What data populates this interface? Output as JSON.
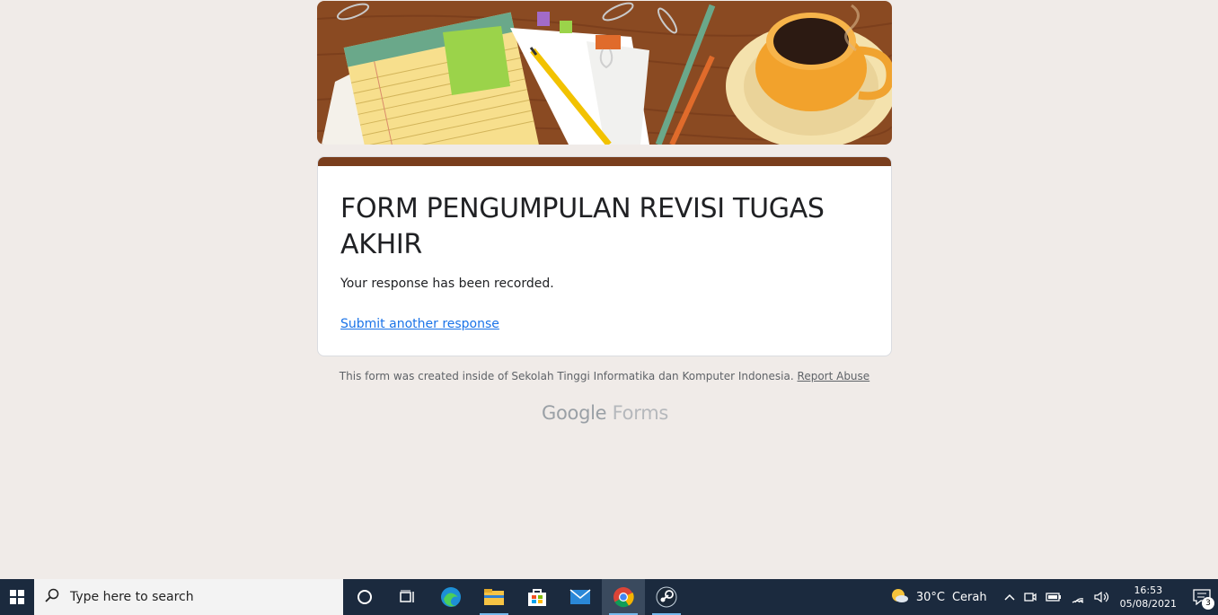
{
  "form": {
    "title": "FORM PENGUMPULAN REVISI TUGAS AKHIR",
    "confirmation": "Your response has been recorded.",
    "submit_another": "Submit another response",
    "accent_color": "#7a3e1d"
  },
  "footer": {
    "created_inside": "This form was created inside of Sekolah Tinggi Informatika dan Komputer Indonesia.",
    "report_abuse": "Report Abuse",
    "logo_google": "Google",
    "logo_forms": "Forms"
  },
  "taskbar": {
    "search_placeholder": "Type here to search",
    "icons": [
      "windows-start-icon",
      "search-icon",
      "cortana-icon",
      "task-view-icon",
      "edge-icon",
      "file-explorer-icon",
      "store-icon",
      "mail-icon",
      "chrome-icon",
      "steam-icon"
    ],
    "weather_temp": "30°C",
    "weather_desc": "Cerah",
    "time": "16:53",
    "date": "05/08/2021",
    "notification_count": "3"
  }
}
